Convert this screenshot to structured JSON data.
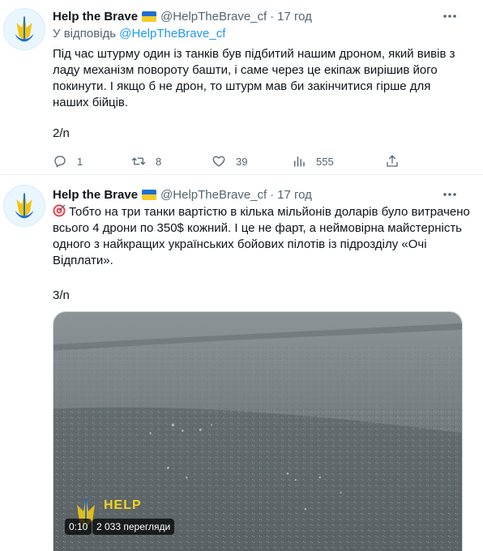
{
  "tweets": [
    {
      "author_name": "Help the Brave",
      "handle": "@HelpTheBrave_cf",
      "separator": "·",
      "time": "17 год",
      "reply_prefix": "У відповідь",
      "reply_handle": "@HelpTheBrave_cf",
      "text": "Під час штурму один із танків був підбитий нашим дроном, який вивів з ладу механізм повороту башти, і саме через це екіпаж вирішив його покинути. І якщо б не дрон, то штурм мав би закінчитися гірше для наших бійців.",
      "thread_position": "2/n",
      "replies": "1",
      "retweets": "8",
      "likes": "39",
      "views": "555",
      "icons": [
        "avatar-logo",
        "ukraine-flag-icon",
        "more-icon",
        "reply-icon",
        "retweet-icon",
        "like-icon",
        "views-icon",
        "share-icon"
      ]
    },
    {
      "author_name": "Help the Brave",
      "handle": "@HelpTheBrave_cf",
      "separator": "·",
      "time": "17 год",
      "text": "Тобто на три танки вартістю в кілька мільйонів доларів було витрачено всього 4 дрони по 350$ кожний. І це не фарт, а неймовірна майстерність одного з найкращих українських бойових пілотів із підрозділу «Очі Відплати».",
      "thread_position": "3/n",
      "icons": [
        "avatar-logo",
        "ukraine-flag-icon",
        "more-icon",
        "target-emoji-icon"
      ],
      "video": {
        "watermark": "HELP",
        "timer": "0:10",
        "views_label": "2 033 перегляди"
      }
    }
  ],
  "colors": {
    "accent": "#1d9bf0",
    "text_secondary": "#536471",
    "flag_blue": "#1d6fd1",
    "flag_yellow": "#f6cc2b"
  }
}
